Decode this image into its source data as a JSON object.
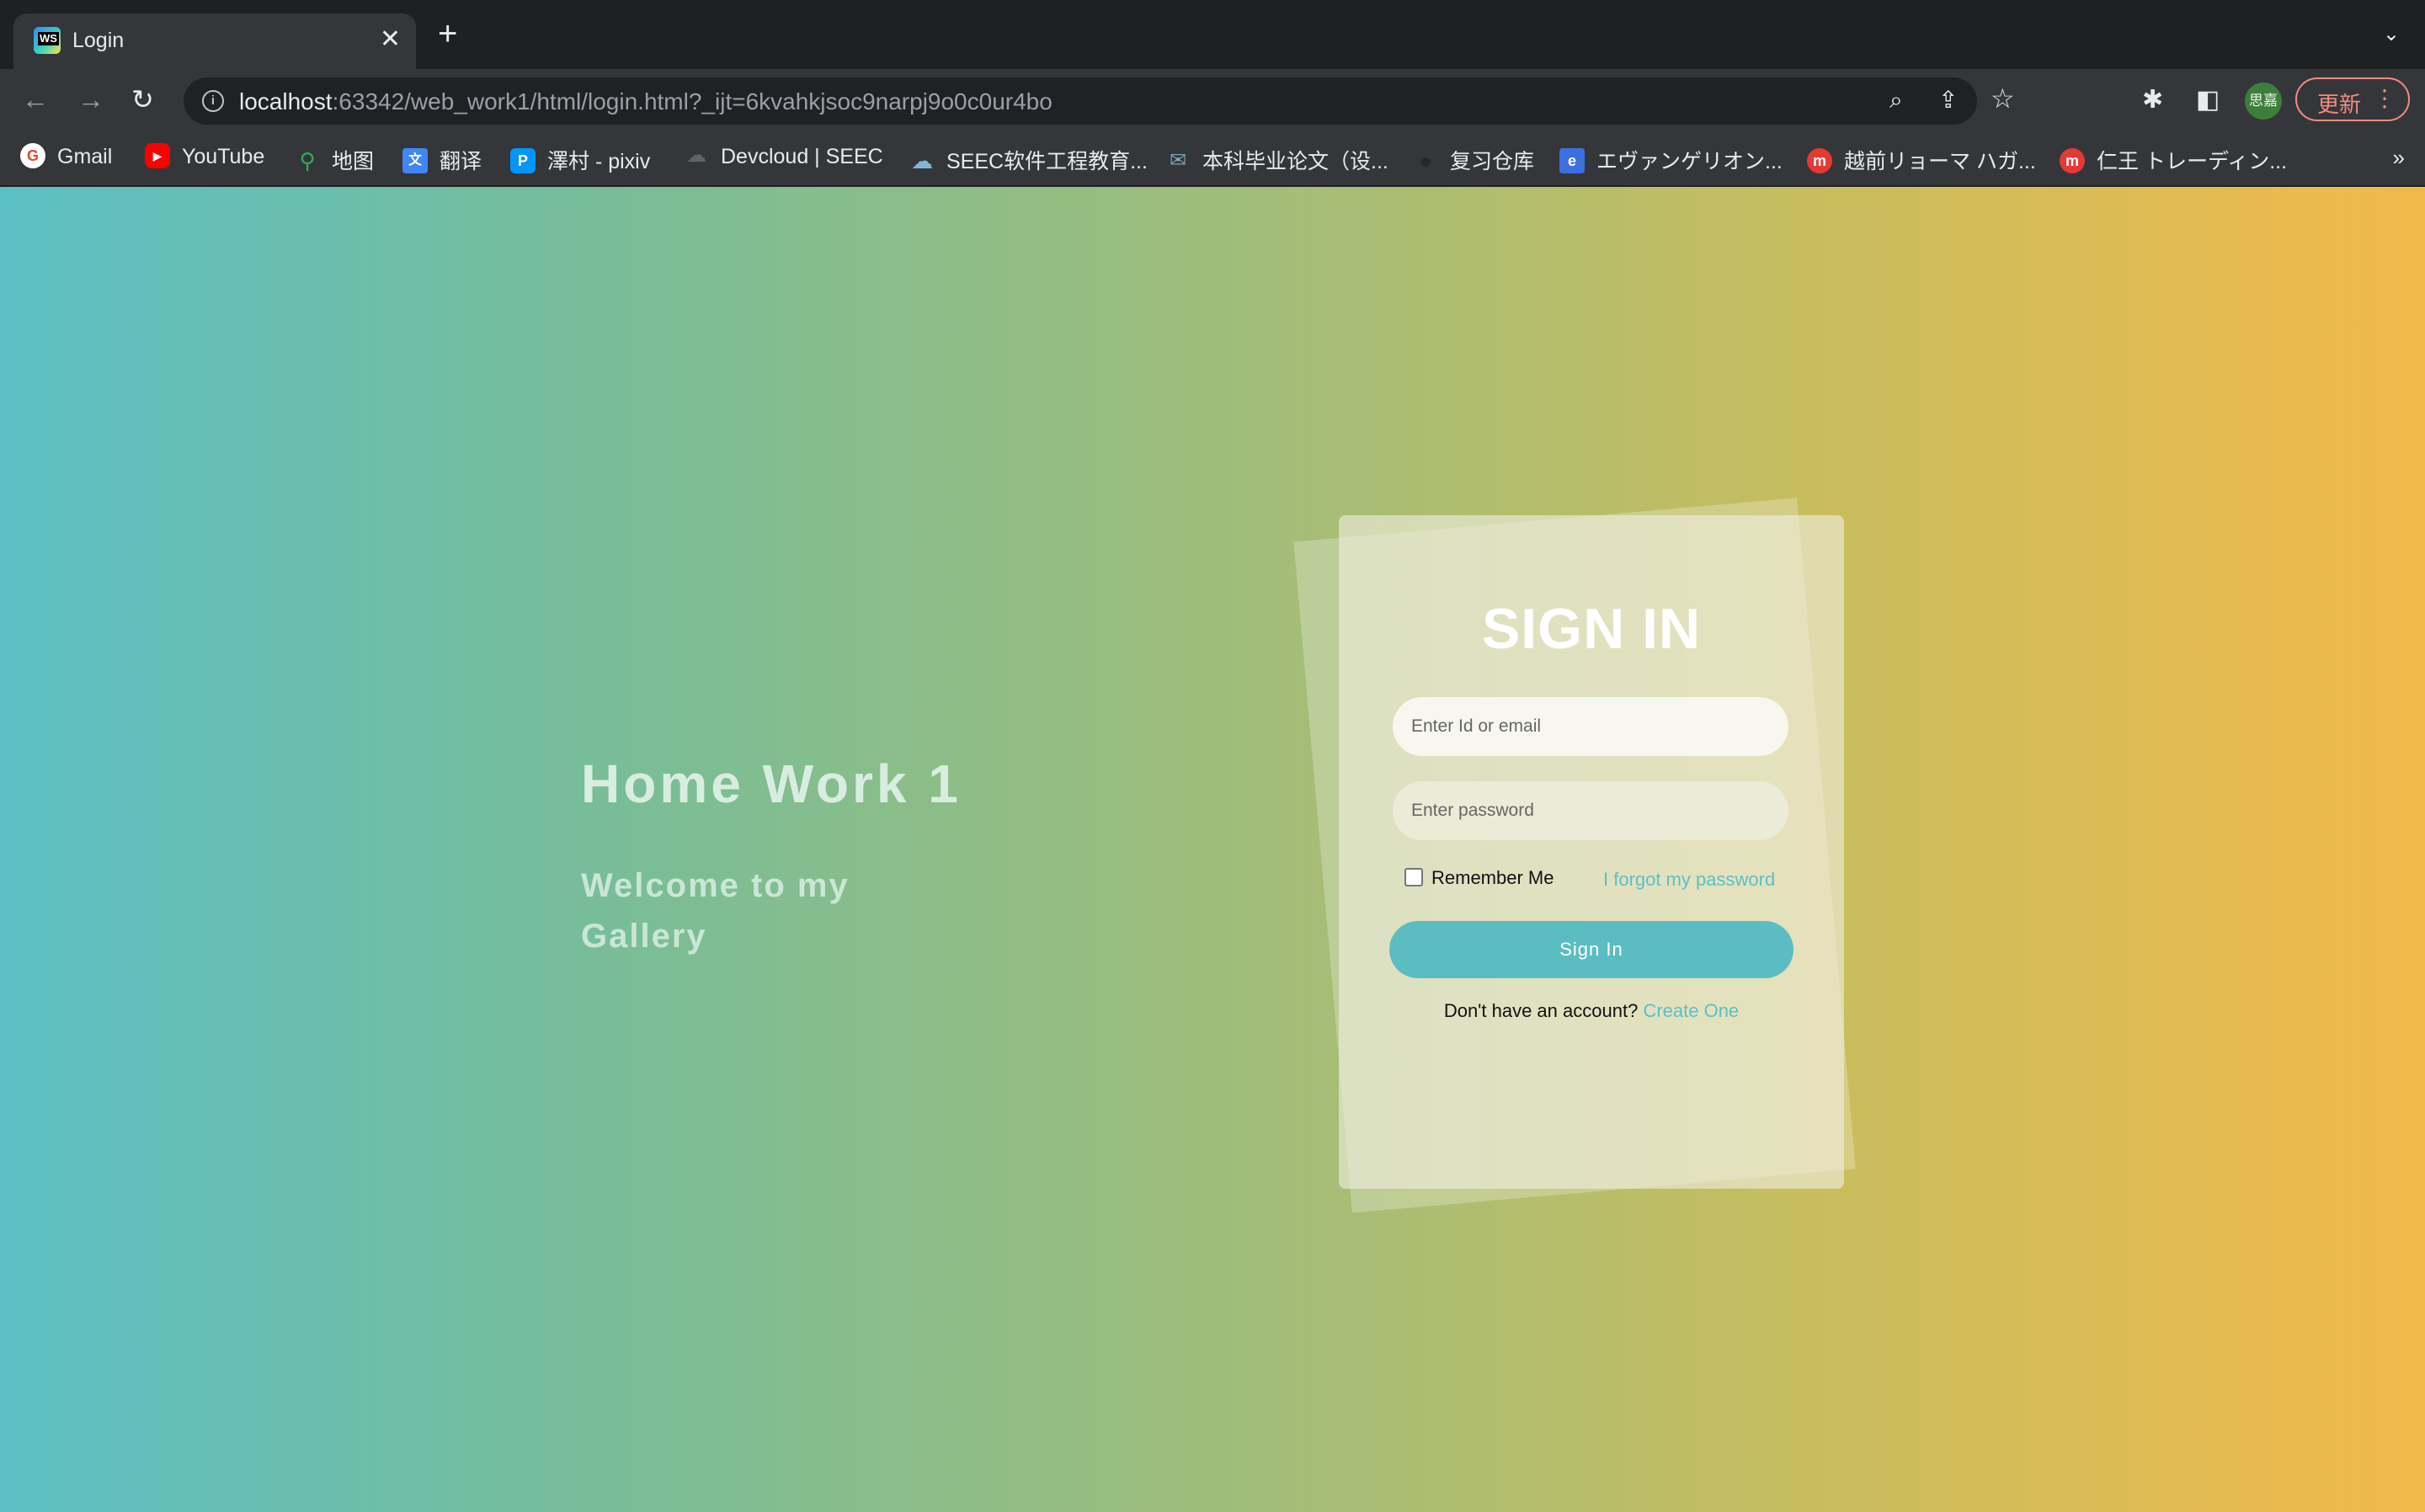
{
  "browser": {
    "tab": {
      "title": "Login",
      "close": "✕"
    },
    "new_tab": "+",
    "tab_list": "⌄",
    "nav": {
      "back": "←",
      "forward": "→",
      "reload": "↻"
    },
    "address": {
      "host": "localhost",
      "rest": ":63342/web_work1/html/login.html?_ijt=6kvahkjsoc9narpj9o0c0ur4bo",
      "info": "i"
    },
    "omnibox_icons": {
      "zoom": "⌕",
      "share": "⇪",
      "star": "☆"
    },
    "extensions": {
      "puzzle": "✱",
      "sidepanel": "◧"
    },
    "profile_avatar": "思嘉",
    "update_button": "更新",
    "menu": "⋮"
  },
  "bookmarks": [
    {
      "label": "Gmail",
      "icon": "google-icon",
      "color": "#ea4335",
      "glyph": "G"
    },
    {
      "label": "YouTube",
      "icon": "youtube-icon",
      "color": "#ff0000",
      "glyph": "▶"
    },
    {
      "label": "地图",
      "icon": "maps-icon",
      "color": "#34a853",
      "glyph": "⚲"
    },
    {
      "label": "翻译",
      "icon": "translate-icon",
      "color": "#4285f4",
      "glyph": "文"
    },
    {
      "label": "澤村 - pixiv",
      "icon": "pixiv-icon",
      "color": "#0096fa",
      "glyph": "P"
    },
    {
      "label": "Devcloud | SEEC",
      "icon": "cloud-icon",
      "color": "#5f6368",
      "glyph": "☁"
    },
    {
      "label": "SEEC软件工程教育...",
      "icon": "cloud-icon",
      "color": "#7fb6d6",
      "glyph": "☁"
    },
    {
      "label": "本科毕业论文（设...",
      "icon": "thesis-icon",
      "color": "#7da3b8",
      "glyph": "✉"
    },
    {
      "label": "复习仓库",
      "icon": "github-icon",
      "color": "#24292e",
      "glyph": "●"
    },
    {
      "label": "エヴァンゲリオン...",
      "icon": "bookmark-icon",
      "color": "#3d6fe0",
      "glyph": "e"
    },
    {
      "label": "越前リョーマ ハガ...",
      "icon": "shop-icon",
      "color": "#e53935",
      "glyph": "m"
    },
    {
      "label": "仁王 トレーディン...",
      "icon": "shop-icon",
      "color": "#e53935",
      "glyph": "m"
    }
  ],
  "bookmarks_more": "»",
  "hero": {
    "title": "Home Work 1",
    "subtitle": "Welcome to my Gallery"
  },
  "login": {
    "title": "SIGN IN",
    "id_placeholder": "Enter Id or email",
    "password_placeholder": "Enter password",
    "remember_label": "Remember Me",
    "forgot_link": "I forgot my password",
    "submit_label": "Sign In",
    "register_prompt": "Don't have an account?",
    "register_link": "Create One"
  },
  "colors": {
    "accent": "#5bbdc1",
    "gradient_start": "#5cbfc4",
    "gradient_end": "#f2b94a"
  }
}
